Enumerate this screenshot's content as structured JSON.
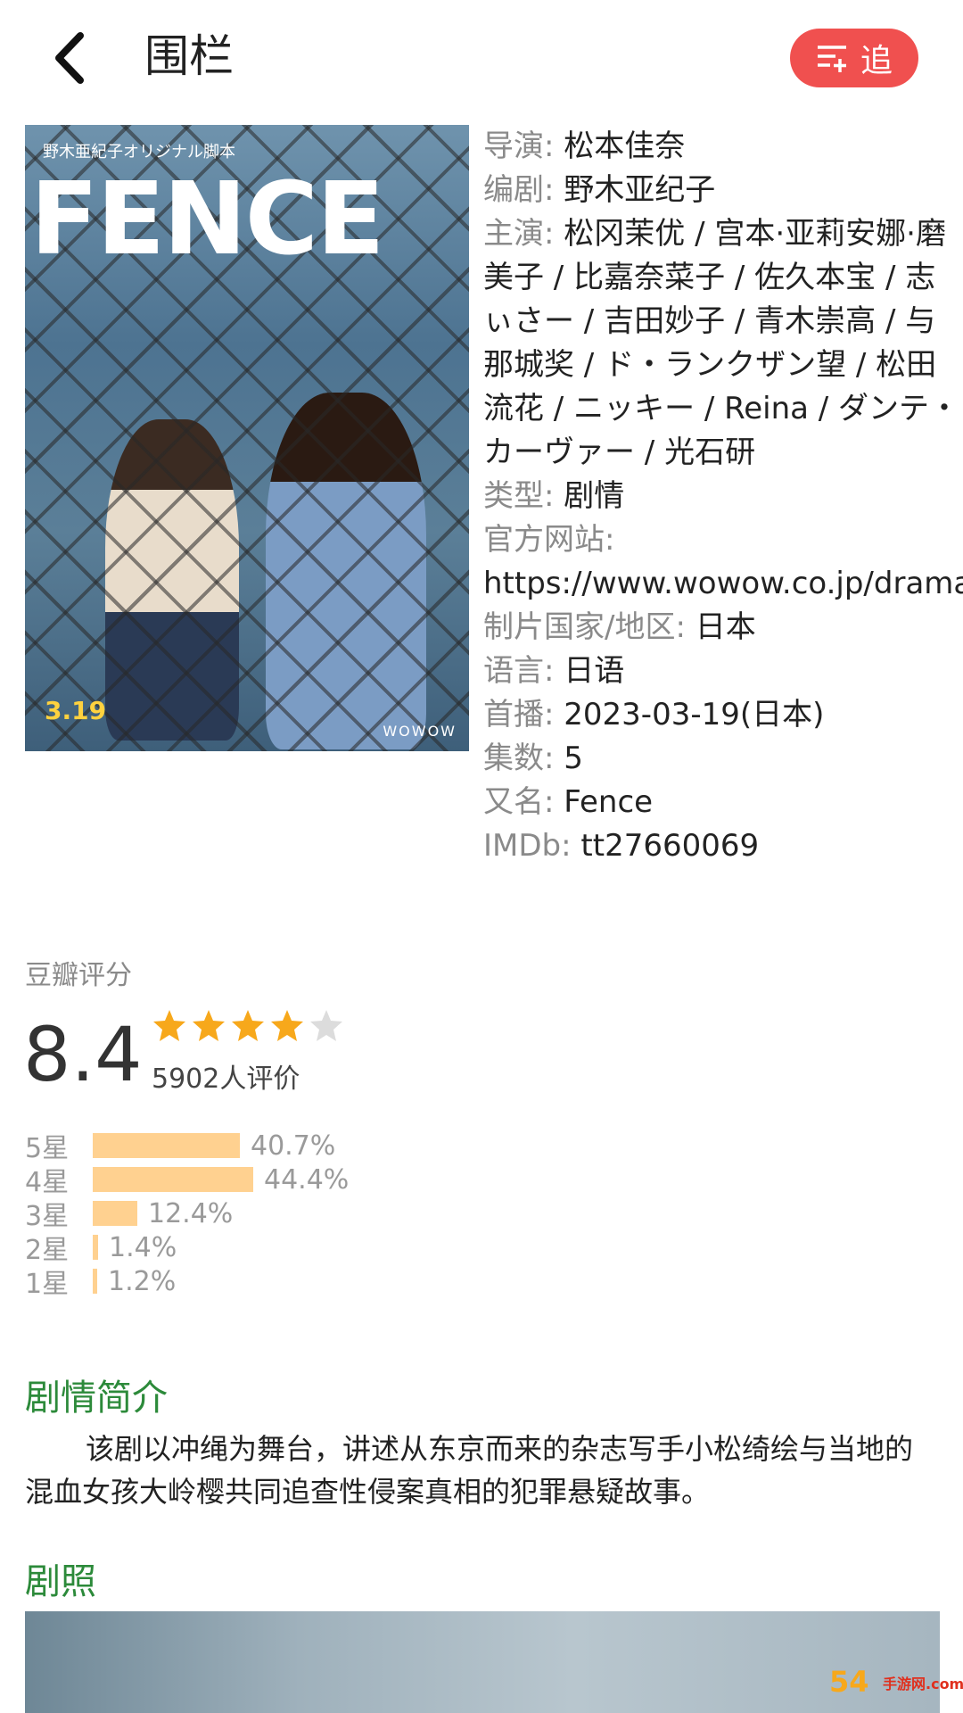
{
  "header": {
    "title": "围栏",
    "follow_label": "追"
  },
  "info": {
    "director_label": "导演:",
    "director": "松本佳奈",
    "writer_label": "编剧:",
    "writer": "野木亚纪子",
    "cast_label": "主演:",
    "cast": "松冈茉优 / 宫本·亚莉安娜·磨美子 / 比嘉奈菜子 / 佐久本宝 / 志ぃさー / 吉田妙子 / 青木崇高 / 与那城奖 / ド・ランクザン望 / 松田流花 / ニッキー / Reina / ダンテ・カーヴァー / 光石研",
    "genre_label": "类型:",
    "genre": "剧情",
    "website_label": "官方网站:",
    "website": "https://www.wowow.co.jp/drama",
    "country_label": "制片国家/地区:",
    "country": "日本",
    "language_label": "语言:",
    "language": "日语",
    "premiere_label": "首播:",
    "premiere": "2023-03-19(日本)",
    "episodes_label": "集数:",
    "episodes": "5",
    "aka_label": "又名:",
    "aka": "Fence",
    "imdb_label": "IMDb:",
    "imdb": "tt27660069"
  },
  "poster": {
    "title": "FENCE",
    "subtitle": "野木亜紀子オリジナル脚本",
    "date": "3.19",
    "brand": "WOWOW"
  },
  "rating": {
    "label": "豆瓣评分",
    "score": "8.4",
    "stars": 4,
    "votes": "5902人评价",
    "distribution": [
      {
        "label": "5星",
        "pct_text": "40.7%",
        "value": 40.7
      },
      {
        "label": "4星",
        "pct_text": "44.4%",
        "value": 44.4
      },
      {
        "label": "3星",
        "pct_text": "12.4%",
        "value": 12.4
      },
      {
        "label": "2星",
        "pct_text": "1.4%",
        "value": 1.4
      },
      {
        "label": "1星",
        "pct_text": "1.2%",
        "value": 1.2
      }
    ]
  },
  "synopsis": {
    "title": "剧情简介",
    "text": "该剧以冲绳为舞台，讲述从东京而来的杂志写手小松绮绘与当地的混血女孩大岭樱共同追查性侵案真相的犯罪悬疑故事。"
  },
  "stills": {
    "title": "剧照"
  },
  "watermark": {
    "main": "54",
    "sub": "手游网.com.cn"
  },
  "colors": {
    "accent": "#f0504f",
    "section": "#2c8a3a",
    "star": "#f7a81b",
    "bar": "#ffd190"
  }
}
